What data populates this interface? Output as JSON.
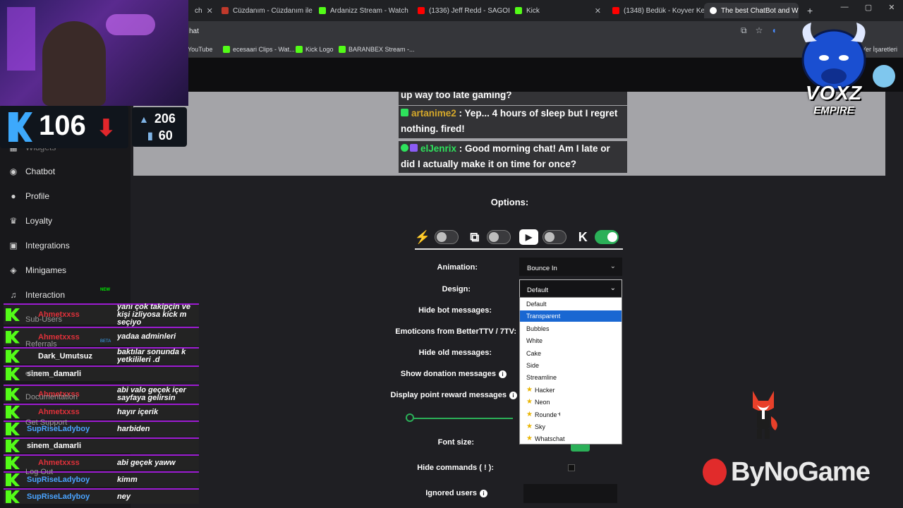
{
  "browser": {
    "tabs": [
      {
        "label": "ch",
        "icon": "tab-icon-partial",
        "color": "#4a4a4a"
      },
      {
        "label": "Cüzdanım - Cüzdanım ile",
        "icon": "tab-icon-wallet",
        "color": "#c0392b"
      },
      {
        "label": "Ardanizz Stream - Watch",
        "icon": "tab-icon-kick",
        "color": "#53fc18"
      },
      {
        "label": "(1336) Jeff Redd - SAGOL",
        "icon": "tab-icon-youtube",
        "color": "#ff0000"
      },
      {
        "label": "Kick",
        "icon": "tab-icon-kick",
        "color": "#53fc18"
      },
      {
        "label": "(1348) Bedük - Koyver Ke",
        "icon": "tab-icon-youtube",
        "color": "#ff0000"
      },
      {
        "label": "The best ChatBot and Wi",
        "icon": "tab-icon-botrix",
        "color": "#ffffff"
      }
    ],
    "new_tab": "+",
    "window_controls": {
      "minimize": "—",
      "maximize": "▢",
      "close": "✕"
    },
    "url": "hat",
    "bookmarks": [
      {
        "label": "YouTube",
        "color": "#ff0000"
      },
      {
        "label": "ecesaari Clips - Wat...",
        "color": "#53fc18"
      },
      {
        "label": "Kick Logo",
        "color": "#53fc18"
      },
      {
        "label": "BARANBEX Stream -...",
        "color": "#53fc18"
      }
    ],
    "bookmarks_right": "Yer İşaretleri"
  },
  "sidebar": {
    "items": [
      {
        "label": "Widgets",
        "icon": "widgets-icon"
      },
      {
        "label": "Chatbot",
        "icon": "robot-icon"
      },
      {
        "label": "Profile",
        "icon": "user-icon"
      },
      {
        "label": "Loyalty",
        "icon": "trophy-icon"
      },
      {
        "label": "Integrations",
        "icon": "grid-icon"
      },
      {
        "label": "Minigames",
        "icon": "gamepad-icon"
      },
      {
        "label": "Interaction",
        "icon": "music-icon"
      }
    ],
    "new_badge": "NEW",
    "faded_items": [
      "Sub-Users",
      "Referrals",
      "eSports",
      "Documentation",
      "Get Support",
      "Log Out"
    ],
    "beta_badge": "BETA"
  },
  "preview": {
    "lines": [
      {
        "user": "",
        "text": "up way too late gaming?",
        "color": "#ffffff"
      },
      {
        "user": "artanime2",
        "text": " : Yep... 4 hours of sleep but I regret nothing. fired!",
        "color": "#d5a82a"
      },
      {
        "user": "elJenrix",
        "text": " : Good morning chat! Am I late or did I actually make it on time for once?",
        "color": "#2ee25c"
      }
    ]
  },
  "options": {
    "title": "Options:",
    "platforms": [
      {
        "name": "botrix-icon",
        "glyph": "⚡",
        "enabled": false
      },
      {
        "name": "twitch-icon",
        "glyph": "⧉",
        "enabled": false
      },
      {
        "name": "youtube-icon",
        "glyph": "▶",
        "enabled": false
      },
      {
        "name": "kick-icon",
        "glyph": "K",
        "enabled": true
      }
    ],
    "animation_label": "Animation:",
    "animation_value": "Bounce In",
    "design_label": "Design:",
    "design_value": "Default",
    "hide_bot_label": "Hide bot messages:",
    "emoticons_label": "Emoticons from BetterTTV / 7TV:",
    "hide_old_label": "Hide old messages:",
    "donation_label": "Show donation messages",
    "point_reward_label": "Display point reward messages",
    "font_size_label": "Font size:",
    "hide_commands_label": "Hide commands ( ! ):",
    "ignored_users_label": "Ignored users",
    "info_glyph": "i",
    "font_slider_fraction": 0.0
  },
  "design_dropdown": {
    "options": [
      {
        "label": "Default",
        "premium": false
      },
      {
        "label": "Transparent",
        "premium": false,
        "selected": true
      },
      {
        "label": "Bubbles",
        "premium": false
      },
      {
        "label": "White",
        "premium": false
      },
      {
        "label": "Cake",
        "premium": false
      },
      {
        "label": "Side",
        "premium": false
      },
      {
        "label": "Streamline",
        "premium": false
      },
      {
        "label": "Hacker",
        "premium": true
      },
      {
        "label": "Neon",
        "premium": true
      },
      {
        "label": "Rounded",
        "premium": true
      },
      {
        "label": "Sky",
        "premium": true
      },
      {
        "label": "Whatschat",
        "premium": true
      }
    ]
  },
  "overlay": {
    "viewers": "106",
    "followers": "206",
    "subs": "60",
    "logo_text": "VOXZ",
    "logo_sub": "EMPIRE",
    "sponsor": "ByNoGame",
    "kick_chat": [
      {
        "user": "Ahmetxxss",
        "msg": "yanı çok takipçin ve kişi izliyosa kick m seçiyo",
        "color": "#e0313a",
        "badge": true
      },
      {
        "user": "Ahmetxxss",
        "msg": "yadaa adminleri",
        "color": "#e0313a",
        "badge": true
      },
      {
        "user": "Dark_Umutsuz",
        "msg": "baktılar sonunda k yetkilileri .d",
        "color": "#ffffff",
        "badge": true
      },
      {
        "user": "sinem_damarli",
        "msg": "",
        "color": "#ffffff",
        "badge": false
      },
      {
        "user": "Ahmetxxss",
        "msg": "abi valo geçek içer sayfaya gelirsin",
        "color": "#e0313a",
        "badge": true
      },
      {
        "user": "Ahmetxxss",
        "msg": "hayır içerik",
        "color": "#e0313a",
        "badge": true
      },
      {
        "user": "SupRiseLadyboy",
        "msg": "harbiden",
        "color": "#4aa3ff",
        "badge": false
      },
      {
        "user": "sinem_damarli",
        "msg": "",
        "color": "#ffffff",
        "badge": false
      },
      {
        "user": "Ahmetxxss",
        "msg": "abi geçek yaww",
        "color": "#e0313a",
        "badge": true
      },
      {
        "user": "SupRiseLadyboy",
        "msg": "kimm",
        "color": "#4aa3ff",
        "badge": false
      },
      {
        "user": "SupRiseLadyboy",
        "msg": "ney",
        "color": "#4aa3ff",
        "badge": false
      }
    ]
  }
}
